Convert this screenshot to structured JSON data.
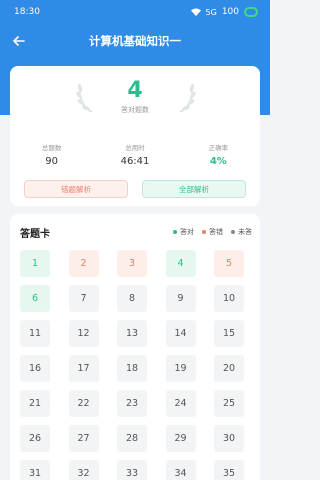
{
  "status": {
    "time": "18:30",
    "battery": "100"
  },
  "header": {
    "title": "计算机基础知识一"
  },
  "summary": {
    "score": "4",
    "score_label": "答对题数",
    "stats": [
      {
        "label": "总题数",
        "value": "90"
      },
      {
        "label": "总用时",
        "value": "46:41"
      },
      {
        "label": "正确率",
        "value": "4%"
      }
    ],
    "wrong_button": "错题解析",
    "all_button": "全部解析"
  },
  "answer_card": {
    "title": "答题卡",
    "legend": [
      {
        "label": "答对",
        "color": "#2abf8a"
      },
      {
        "label": "答错",
        "color": "#e8806c"
      },
      {
        "label": "未答",
        "color": "#888888"
      }
    ],
    "cells": [
      {
        "n": "1",
        "s": "right"
      },
      {
        "n": "2",
        "s": "wrong"
      },
      {
        "n": "3",
        "s": "wrong"
      },
      {
        "n": "4",
        "s": "right"
      },
      {
        "n": "5",
        "s": "wrong"
      },
      {
        "n": "6",
        "s": "right"
      },
      {
        "n": "7",
        "s": "none"
      },
      {
        "n": "8",
        "s": "none"
      },
      {
        "n": "9",
        "s": "none"
      },
      {
        "n": "10",
        "s": "none"
      },
      {
        "n": "11",
        "s": "none"
      },
      {
        "n": "12",
        "s": "none"
      },
      {
        "n": "13",
        "s": "none"
      },
      {
        "n": "14",
        "s": "none"
      },
      {
        "n": "15",
        "s": "none"
      },
      {
        "n": "16",
        "s": "none"
      },
      {
        "n": "17",
        "s": "none"
      },
      {
        "n": "18",
        "s": "none"
      },
      {
        "n": "19",
        "s": "none"
      },
      {
        "n": "20",
        "s": "none"
      },
      {
        "n": "21",
        "s": "none"
      },
      {
        "n": "22",
        "s": "none"
      },
      {
        "n": "23",
        "s": "none"
      },
      {
        "n": "24",
        "s": "none"
      },
      {
        "n": "25",
        "s": "none"
      },
      {
        "n": "26",
        "s": "none"
      },
      {
        "n": "27",
        "s": "none"
      },
      {
        "n": "28",
        "s": "none"
      },
      {
        "n": "29",
        "s": "none"
      },
      {
        "n": "30",
        "s": "none"
      },
      {
        "n": "31",
        "s": "none"
      },
      {
        "n": "32",
        "s": "none"
      },
      {
        "n": "33",
        "s": "none"
      },
      {
        "n": "34",
        "s": "none"
      },
      {
        "n": "35",
        "s": "none"
      }
    ]
  }
}
